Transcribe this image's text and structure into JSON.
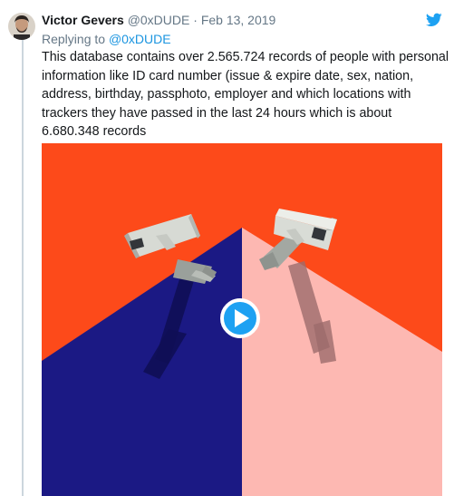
{
  "tweet": {
    "author_name": "Victor Gevers",
    "handle": "@0xDUDE",
    "separator": "·",
    "date": "Feb 13, 2019",
    "reply_prefix": "Replying to",
    "reply_handle": "@0xDUDE",
    "text_lines": [
      "This database contains over 2.565.724 records of people with personal",
      "information like ID card number (issue & expire date, sex, nation,",
      "address, birthday, passphoto, employer and which locations with",
      "trackers they have passed in the last 24 hours which is about",
      "6.680.348 records"
    ]
  },
  "icons": {
    "platform": "twitter-bird-icon",
    "media_overlay": "play-icon"
  },
  "colors": {
    "brand_blue": "#1da1f2",
    "link_blue": "#1b95e0",
    "media_red": "#fd4a1a",
    "media_navy": "#1b1984",
    "media_pink": "#fdb8b2"
  }
}
